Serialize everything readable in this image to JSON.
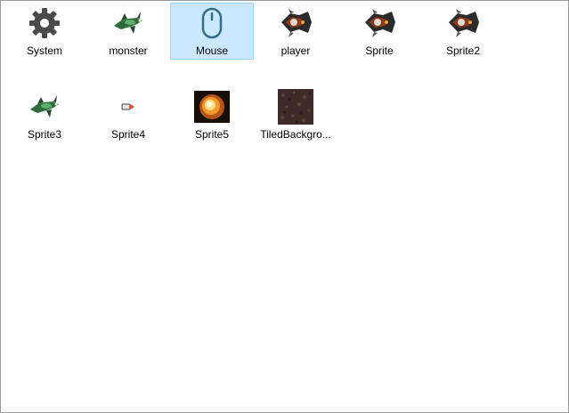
{
  "objects": [
    {
      "label": "System",
      "icon": "gear-icon",
      "selected": false
    },
    {
      "label": "monster",
      "icon": "green-monster-icon",
      "selected": false
    },
    {
      "label": "Mouse",
      "icon": "mouse-icon",
      "selected": true
    },
    {
      "label": "player",
      "icon": "player-ship-icon",
      "selected": false
    },
    {
      "label": "Sprite",
      "icon": "player-ship-icon",
      "selected": false
    },
    {
      "label": "Sprite2",
      "icon": "player-ship-icon",
      "selected": false
    },
    {
      "label": "Sprite3",
      "icon": "green-monster-icon",
      "selected": false
    },
    {
      "label": "Sprite4",
      "icon": "bullet-icon",
      "selected": false
    },
    {
      "label": "Sprite5",
      "icon": "explosion-icon",
      "selected": false
    },
    {
      "label": "TiledBackgro...",
      "icon": "tiled-background-icon",
      "selected": false
    }
  ],
  "colors": {
    "selection": "#cce8ff",
    "selection_border": "#99d1ff",
    "border": "#9a9a9a"
  }
}
